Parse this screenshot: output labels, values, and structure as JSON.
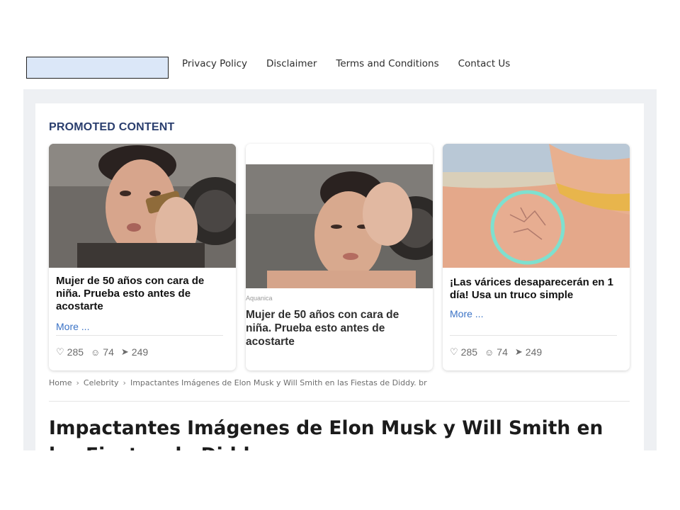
{
  "nav": {
    "items": [
      "Privacy Policy",
      "Disclaimer",
      "Terms and Conditions",
      "Contact Us"
    ]
  },
  "promoted": {
    "title": "PROMOTED CONTENT",
    "cards": [
      {
        "title": "Mujer de 50 años con cara de niña. Prueba esto antes de acostarte",
        "more": "More ...",
        "likes": "285",
        "comments": "74",
        "shares": "249"
      },
      {
        "sponsor": "Aquanica",
        "title": "Mujer de 50 años con cara de niña. Prueba esto antes de acostarte"
      },
      {
        "title": "¡Las várices desaparecerán en 1 día! Usa un truco simple",
        "more": "More ...",
        "likes": "285",
        "comments": "74",
        "shares": "249"
      }
    ]
  },
  "breadcrumb": [
    "Home",
    "Celebrity",
    "Impactantes Imágenes de Elon Musk y Will Smith en las Fiestas de Diddy. br"
  ],
  "article": {
    "headline": "Impactantes Imágenes de Elon Musk y Will Smith en las Fiestas de Diddy"
  },
  "icons": {
    "like": "heart-icon",
    "comment": "comment-icon",
    "share": "send-icon",
    "separator": "chevron-right-icon"
  },
  "colors": {
    "accent": "#2a3e6e",
    "link": "#3b73c6",
    "logo_placeholder": "#dbe7f8"
  }
}
